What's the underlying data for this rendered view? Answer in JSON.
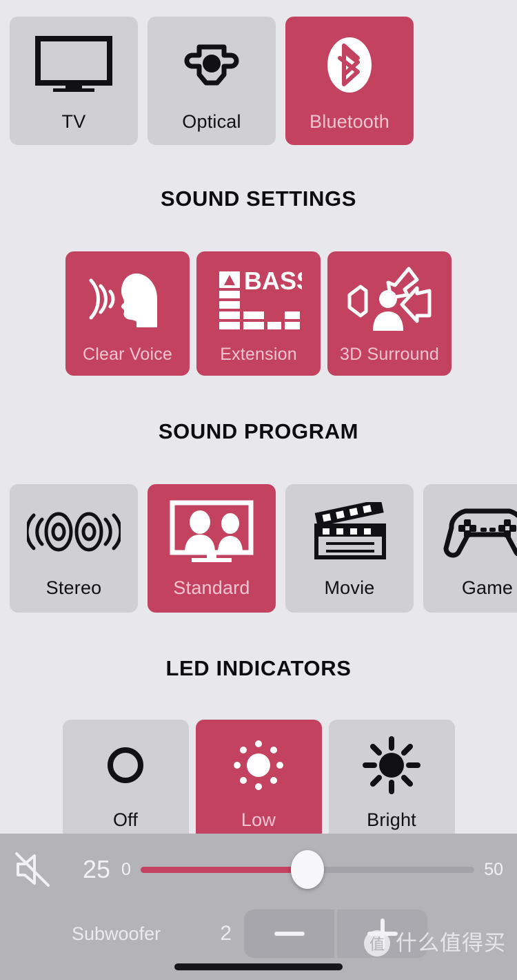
{
  "theme": {
    "background": "#e8e7ec",
    "card_inactive": "#d0cfd4",
    "card_active": "#c24260",
    "bottom_bar": "#b4b3b8",
    "active_label": "#f0c5d0",
    "inactive_label": "#111014"
  },
  "sources": {
    "items": [
      {
        "label": "TV",
        "icon": "tv-icon",
        "active": false
      },
      {
        "label": "Optical",
        "icon": "optical-icon",
        "active": false
      },
      {
        "label": "Bluetooth",
        "icon": "bluetooth-icon",
        "active": true
      }
    ]
  },
  "sound_settings": {
    "title": "SOUND SETTINGS",
    "items": [
      {
        "label": "Clear Voice",
        "icon": "clear-voice-icon",
        "active": true
      },
      {
        "label": "Extension",
        "icon": "bass-extension-icon",
        "active": true
      },
      {
        "label": "3D Surround",
        "icon": "surround-icon",
        "active": true
      }
    ]
  },
  "sound_program": {
    "title": "SOUND PROGRAM",
    "items": [
      {
        "label": "Stereo",
        "icon": "stereo-speakers-icon",
        "active": false
      },
      {
        "label": "Standard",
        "icon": "tv-people-icon",
        "active": true
      },
      {
        "label": "Movie",
        "icon": "clapperboard-icon",
        "active": false
      },
      {
        "label": "Game",
        "icon": "gamepad-icon",
        "active": false
      }
    ]
  },
  "led_indicators": {
    "title": "LED INDICATORS",
    "items": [
      {
        "label": "Off",
        "icon": "circle-outline-icon",
        "active": false
      },
      {
        "label": "Low",
        "icon": "sun-low-icon",
        "active": true
      },
      {
        "label": "Bright",
        "icon": "sun-bright-icon",
        "active": false
      }
    ]
  },
  "volume": {
    "mute_icon": "mute-icon",
    "value": "25",
    "min": "0",
    "max": "50",
    "fill_percent": 50
  },
  "subwoofer": {
    "label": "Subwoofer",
    "value": "2",
    "decrease_icon": "minus-icon",
    "increase_icon": "plus-icon"
  },
  "watermark": {
    "logo": "值",
    "text": "什么值得买"
  }
}
